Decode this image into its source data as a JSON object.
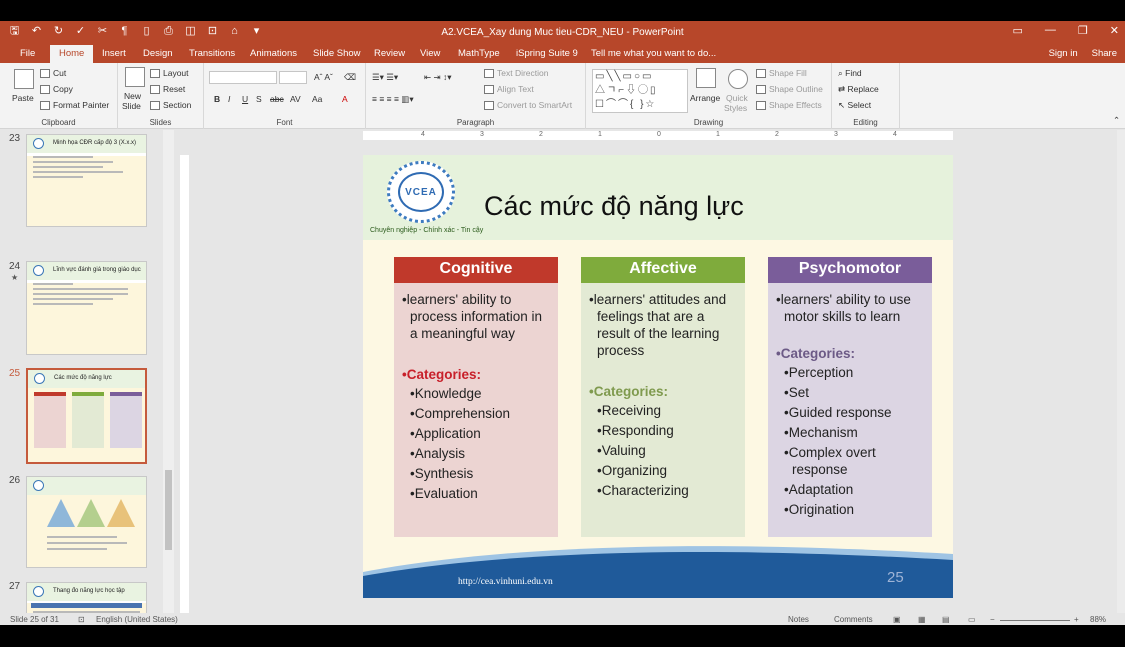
{
  "window": {
    "title": "A2.VCEA_Xay dung Muc tieu-CDR_NEU - PowerPoint",
    "controls": [
      "▭",
      "—",
      "❐",
      "✕"
    ]
  },
  "tabs": [
    "File",
    "Home",
    "Insert",
    "Design",
    "Transitions",
    "Animations",
    "Slide Show",
    "Review",
    "View",
    "MathType",
    "iSpring Suite 9",
    "Tell me what you want to do..."
  ],
  "account": {
    "signin": "Sign in",
    "share": "Share"
  },
  "ribbon": {
    "clipboard": {
      "paste": "Paste",
      "cut": "Cut",
      "copy": "Copy",
      "format_painter": "Format Painter",
      "label": "Clipboard"
    },
    "slides": {
      "new_slide_1": "New",
      "new_slide_2": "Slide",
      "layout": "Layout",
      "reset": "Reset",
      "section": "Section",
      "label": "Slides"
    },
    "font": {
      "label": "Font",
      "bold": "B",
      "italic": "I",
      "underline": "U",
      "shadow": "S",
      "strike": "abc",
      "spacing": "AV",
      "case": "Aa",
      "color": "A"
    },
    "paragraph": {
      "text_direction": "Text Direction",
      "align_text": "Align Text",
      "smartart": "Convert to SmartArt",
      "label": "Paragraph"
    },
    "drawing": {
      "arrange": "Arrange",
      "quick_styles_1": "Quick",
      "quick_styles_2": "Styles",
      "shape_fill": "Shape Fill",
      "shape_outline": "Shape Outline",
      "shape_effects": "Shape Effects",
      "label": "Drawing"
    },
    "editing": {
      "find": "Find",
      "replace": "Replace",
      "select": "Select",
      "label": "Editing"
    }
  },
  "thumbnails": [
    {
      "num": "23",
      "title": "Minh họa CĐR cấp độ 3 (X.x.x)"
    },
    {
      "num": "24",
      "title": "Lĩnh vực đánh giá trong giáo dục"
    },
    {
      "num": "25",
      "title": "Các mức độ năng lực"
    },
    {
      "num": "26",
      "title": ""
    },
    {
      "num": "27",
      "title": "Thang đo năng lực học tập"
    }
  ],
  "ruler": {
    "h_ticks": [
      "4",
      "3",
      "2",
      "1",
      "0",
      "1",
      "2",
      "3",
      "4"
    ]
  },
  "slide": {
    "logo_text": "VCEA",
    "tagline": "Chuyên nghiệp - Chính xác - Tin cậy",
    "title": "Các mức độ năng lực",
    "columns": [
      {
        "header": "Cognitive",
        "color": "#c0392b",
        "body_bg": "#ecd4d2",
        "desc": "•learners' ability to process information in a meaningful way",
        "cat_label": "•Categories:",
        "cat_color": "#c8202a",
        "items": [
          "•Knowledge",
          "•Comprehension",
          "•Application",
          "•Analysis",
          "•Synthesis",
          "•Evaluation"
        ]
      },
      {
        "header": "Affective",
        "color": "#7fab3c",
        "body_bg": "#e3ead4",
        "desc": "•learners' attitudes and feelings that are a result of the learning process",
        "cat_label": "•Categories:",
        "cat_color": "#7f9a4e",
        "items": [
          "•Receiving",
          "•Responding",
          "•Valuing",
          "•Organizing",
          "•Characterizing"
        ]
      },
      {
        "header": "Psychomotor",
        "color": "#7a5d9a",
        "body_bg": "#dcd5e3",
        "desc": "•learners' ability to use motor skills to learn",
        "cat_label": "•Categories:",
        "cat_color": "#6c5a86",
        "items": [
          "•Perception",
          "•Set",
          "•Guided response",
          "•Mechanism",
          "•Complex overt response",
          "•Adaptation",
          "•Origination"
        ]
      }
    ],
    "url": "http://cea.vinhuni.edu.vn",
    "number": "25"
  },
  "status": {
    "slide_of": "Slide 25 of 31",
    "language": "English (United States)",
    "notes": "Notes",
    "comments": "Comments",
    "zoom": "88%"
  }
}
